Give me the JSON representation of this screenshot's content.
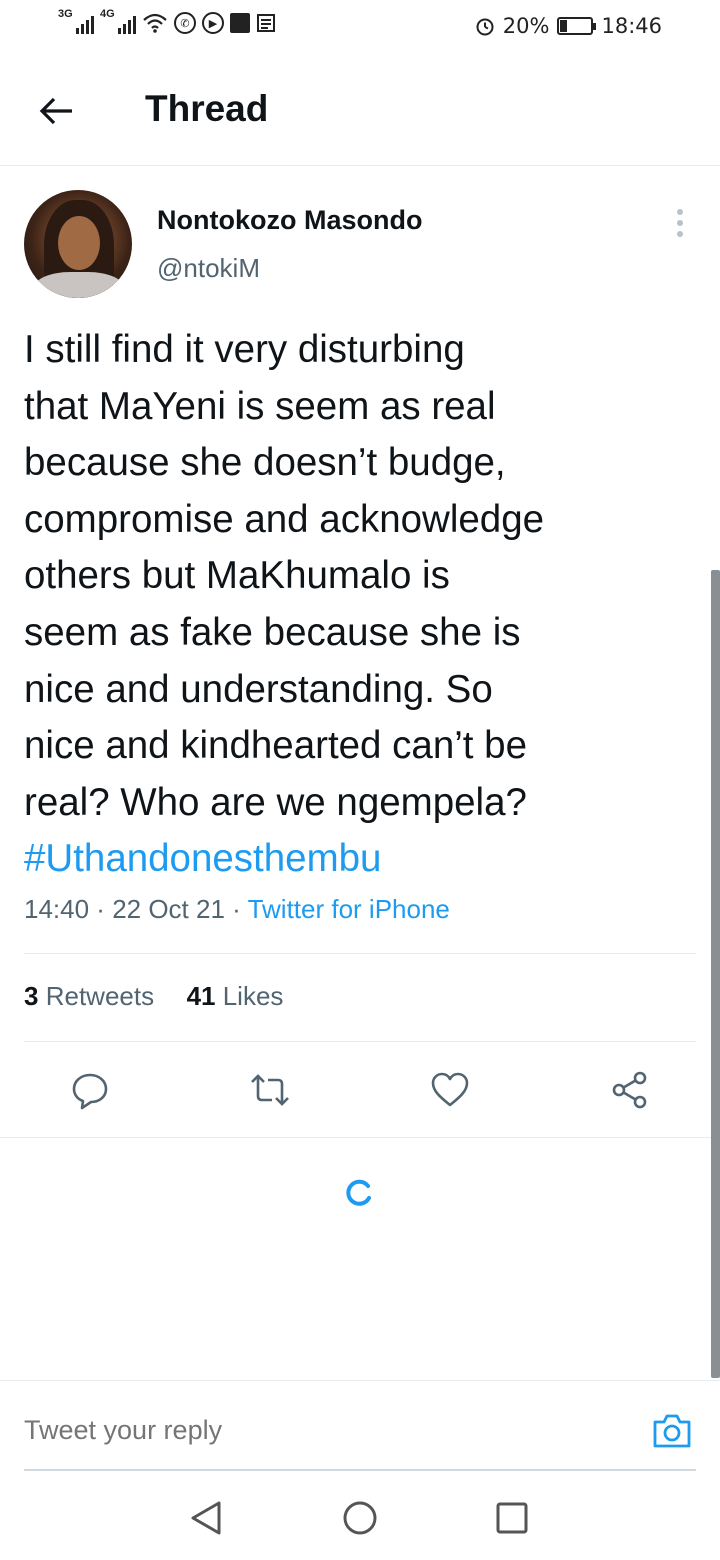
{
  "status_bar": {
    "signal_1_tag": "3G",
    "signal_2_tag": "4G",
    "alarm_icon": "alarm-icon",
    "battery_percent": "20%",
    "battery_level": 0.2,
    "time": "18:46"
  },
  "header": {
    "back_icon": "arrow-left-icon",
    "title": "Thread"
  },
  "tweet": {
    "author_name": "Nontokozo Masondo",
    "author_handle": "@ntokiM",
    "text_lines": [
      "I still find it very disturbing",
      "that MaYeni is seem as real",
      "because she doesn’t budge,",
      "compromise and acknowledge",
      "others but MaKhumalo is",
      "seem as fake because she is",
      "nice and understanding. So",
      "nice and kindhearted can’t be",
      "real? Who are we ngempela?"
    ],
    "hashtag": "#Uthandonesthembu",
    "time": "14:40",
    "date": "22 Oct 21",
    "source": "Twitter for iPhone",
    "separator": " · ",
    "retweets_count": "3",
    "retweets_label": "Retweets",
    "likes_count": "41",
    "likes_label": "Likes"
  },
  "actions": {
    "reply_icon": "reply-icon",
    "retweet_icon": "retweet-icon",
    "like_icon": "heart-icon",
    "share_icon": "share-icon"
  },
  "reply": {
    "placeholder": "Tweet your reply",
    "camera_icon": "camera-icon"
  },
  "colors": {
    "accent": "#1d9bf0",
    "text_primary": "#0f1419",
    "text_secondary": "#536471",
    "divider": "#e6ecf0"
  }
}
